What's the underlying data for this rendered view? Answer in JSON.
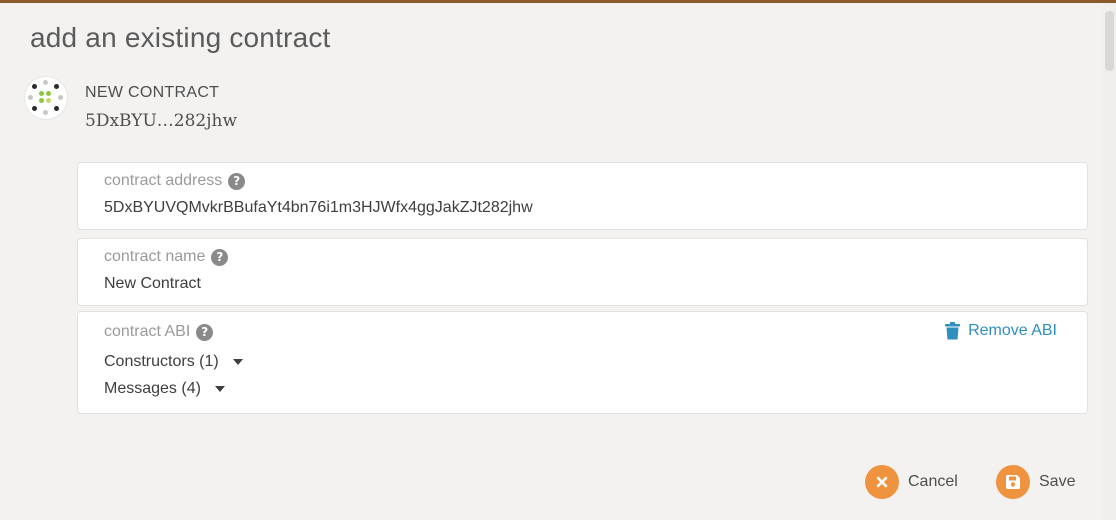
{
  "modal": {
    "title": "add an existing contract"
  },
  "header": {
    "contract_name": "NEW CONTRACT",
    "address_short": "5DxBYU…282jhw",
    "identicon_icon": "identicon"
  },
  "fields": {
    "address": {
      "label": "contract address",
      "value": "5DxBYUVQMvkrBBufaYt4bn76i1m3HJWfx4ggJakZJt282jhw",
      "help_icon": "question-circle-icon"
    },
    "name": {
      "label": "contract name",
      "value": "New Contract",
      "help_icon": "question-circle-icon"
    },
    "abi": {
      "label": "contract ABI",
      "help_icon": "question-circle-icon",
      "remove_label": "Remove ABI",
      "remove_icon": "trash-icon",
      "constructors_label": "Constructors (1)",
      "messages_label": "Messages (4)"
    }
  },
  "actions": {
    "cancel_label": "Cancel",
    "cancel_icon": "close-icon",
    "save_label": "Save",
    "save_icon": "save-icon"
  },
  "colors": {
    "accent": "#f0933f",
    "link": "#2f8fbf",
    "topbar": "#8a5a2b"
  }
}
